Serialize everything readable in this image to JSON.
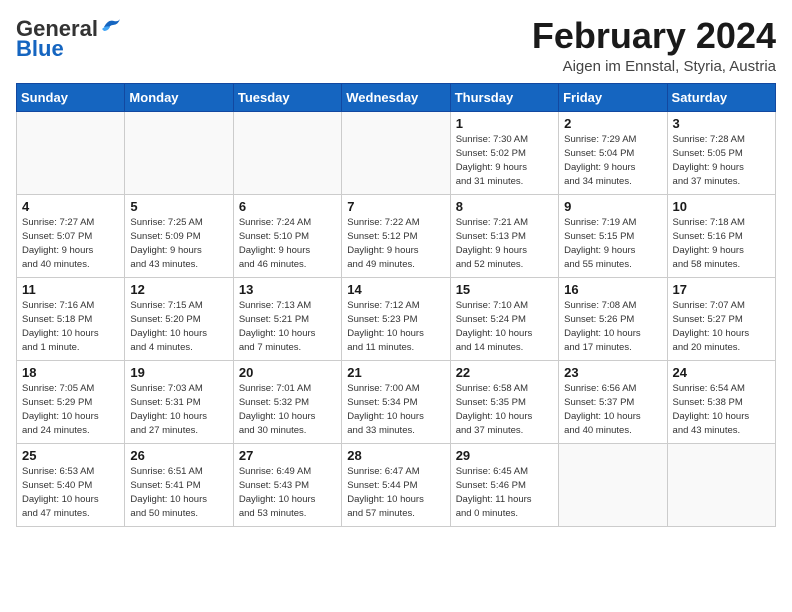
{
  "header": {
    "logo_general": "General",
    "logo_blue": "Blue",
    "month_title": "February 2024",
    "location": "Aigen im Ennstal, Styria, Austria"
  },
  "weekdays": [
    "Sunday",
    "Monday",
    "Tuesday",
    "Wednesday",
    "Thursday",
    "Friday",
    "Saturday"
  ],
  "weeks": [
    [
      {
        "day": "",
        "info": ""
      },
      {
        "day": "",
        "info": ""
      },
      {
        "day": "",
        "info": ""
      },
      {
        "day": "",
        "info": ""
      },
      {
        "day": "1",
        "info": "Sunrise: 7:30 AM\nSunset: 5:02 PM\nDaylight: 9 hours\nand 31 minutes."
      },
      {
        "day": "2",
        "info": "Sunrise: 7:29 AM\nSunset: 5:04 PM\nDaylight: 9 hours\nand 34 minutes."
      },
      {
        "day": "3",
        "info": "Sunrise: 7:28 AM\nSunset: 5:05 PM\nDaylight: 9 hours\nand 37 minutes."
      }
    ],
    [
      {
        "day": "4",
        "info": "Sunrise: 7:27 AM\nSunset: 5:07 PM\nDaylight: 9 hours\nand 40 minutes."
      },
      {
        "day": "5",
        "info": "Sunrise: 7:25 AM\nSunset: 5:09 PM\nDaylight: 9 hours\nand 43 minutes."
      },
      {
        "day": "6",
        "info": "Sunrise: 7:24 AM\nSunset: 5:10 PM\nDaylight: 9 hours\nand 46 minutes."
      },
      {
        "day": "7",
        "info": "Sunrise: 7:22 AM\nSunset: 5:12 PM\nDaylight: 9 hours\nand 49 minutes."
      },
      {
        "day": "8",
        "info": "Sunrise: 7:21 AM\nSunset: 5:13 PM\nDaylight: 9 hours\nand 52 minutes."
      },
      {
        "day": "9",
        "info": "Sunrise: 7:19 AM\nSunset: 5:15 PM\nDaylight: 9 hours\nand 55 minutes."
      },
      {
        "day": "10",
        "info": "Sunrise: 7:18 AM\nSunset: 5:16 PM\nDaylight: 9 hours\nand 58 minutes."
      }
    ],
    [
      {
        "day": "11",
        "info": "Sunrise: 7:16 AM\nSunset: 5:18 PM\nDaylight: 10 hours\nand 1 minute."
      },
      {
        "day": "12",
        "info": "Sunrise: 7:15 AM\nSunset: 5:20 PM\nDaylight: 10 hours\nand 4 minutes."
      },
      {
        "day": "13",
        "info": "Sunrise: 7:13 AM\nSunset: 5:21 PM\nDaylight: 10 hours\nand 7 minutes."
      },
      {
        "day": "14",
        "info": "Sunrise: 7:12 AM\nSunset: 5:23 PM\nDaylight: 10 hours\nand 11 minutes."
      },
      {
        "day": "15",
        "info": "Sunrise: 7:10 AM\nSunset: 5:24 PM\nDaylight: 10 hours\nand 14 minutes."
      },
      {
        "day": "16",
        "info": "Sunrise: 7:08 AM\nSunset: 5:26 PM\nDaylight: 10 hours\nand 17 minutes."
      },
      {
        "day": "17",
        "info": "Sunrise: 7:07 AM\nSunset: 5:27 PM\nDaylight: 10 hours\nand 20 minutes."
      }
    ],
    [
      {
        "day": "18",
        "info": "Sunrise: 7:05 AM\nSunset: 5:29 PM\nDaylight: 10 hours\nand 24 minutes."
      },
      {
        "day": "19",
        "info": "Sunrise: 7:03 AM\nSunset: 5:31 PM\nDaylight: 10 hours\nand 27 minutes."
      },
      {
        "day": "20",
        "info": "Sunrise: 7:01 AM\nSunset: 5:32 PM\nDaylight: 10 hours\nand 30 minutes."
      },
      {
        "day": "21",
        "info": "Sunrise: 7:00 AM\nSunset: 5:34 PM\nDaylight: 10 hours\nand 33 minutes."
      },
      {
        "day": "22",
        "info": "Sunrise: 6:58 AM\nSunset: 5:35 PM\nDaylight: 10 hours\nand 37 minutes."
      },
      {
        "day": "23",
        "info": "Sunrise: 6:56 AM\nSunset: 5:37 PM\nDaylight: 10 hours\nand 40 minutes."
      },
      {
        "day": "24",
        "info": "Sunrise: 6:54 AM\nSunset: 5:38 PM\nDaylight: 10 hours\nand 43 minutes."
      }
    ],
    [
      {
        "day": "25",
        "info": "Sunrise: 6:53 AM\nSunset: 5:40 PM\nDaylight: 10 hours\nand 47 minutes."
      },
      {
        "day": "26",
        "info": "Sunrise: 6:51 AM\nSunset: 5:41 PM\nDaylight: 10 hours\nand 50 minutes."
      },
      {
        "day": "27",
        "info": "Sunrise: 6:49 AM\nSunset: 5:43 PM\nDaylight: 10 hours\nand 53 minutes."
      },
      {
        "day": "28",
        "info": "Sunrise: 6:47 AM\nSunset: 5:44 PM\nDaylight: 10 hours\nand 57 minutes."
      },
      {
        "day": "29",
        "info": "Sunrise: 6:45 AM\nSunset: 5:46 PM\nDaylight: 11 hours\nand 0 minutes."
      },
      {
        "day": "",
        "info": ""
      },
      {
        "day": "",
        "info": ""
      }
    ]
  ]
}
